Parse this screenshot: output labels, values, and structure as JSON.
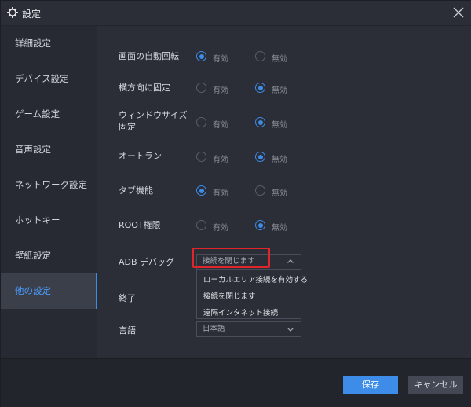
{
  "window": {
    "title": "設定"
  },
  "sidebar": {
    "items": [
      {
        "label": "詳細設定"
      },
      {
        "label": "デバイス設定"
      },
      {
        "label": "ゲーム設定"
      },
      {
        "label": "音声設定"
      },
      {
        "label": "ネットワーク設定"
      },
      {
        "label": "ホットキー"
      },
      {
        "label": "壁紙設定"
      },
      {
        "label": "他の設定",
        "active": true
      }
    ]
  },
  "options": {
    "enabled_label": "有効",
    "disabled_label": "無効",
    "rows": [
      {
        "label": "画面の自動回転",
        "selected": "enabled"
      },
      {
        "label": "横方向に固定",
        "selected": "disabled"
      },
      {
        "label": "ウィンドウサイズ",
        "label2": "固定",
        "selected": "disabled"
      },
      {
        "label": "オートラン",
        "selected": "disabled"
      },
      {
        "label": "タブ機能",
        "selected": "enabled"
      },
      {
        "label": "ROOT権限",
        "selected": "disabled"
      }
    ]
  },
  "adb": {
    "label": "ADB デバッグ",
    "value": "接続を閉じます",
    "options": [
      "ローカルエリア接続を有効する",
      "接続を閉じます",
      "遠隔インタネット接続"
    ]
  },
  "exit": {
    "label": "終了"
  },
  "language": {
    "label": "言語",
    "value": "日本語"
  },
  "footer": {
    "save_label": "保存",
    "cancel_label": "キャンセル"
  },
  "colors": {
    "accent": "#3c8ce8",
    "highlight": "#e0262b",
    "background": "#2b2e37"
  }
}
